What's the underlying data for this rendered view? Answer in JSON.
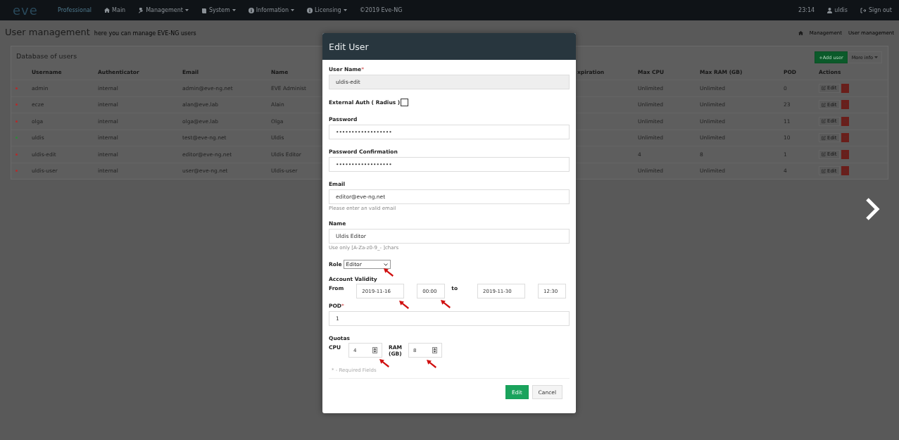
{
  "navbar": {
    "logo": "eve",
    "edition": "Professional",
    "menu": [
      {
        "label": "Main",
        "dropdown": false
      },
      {
        "label": "Management",
        "dropdown": true
      },
      {
        "label": "System",
        "dropdown": true
      },
      {
        "label": "Information",
        "dropdown": true
      },
      {
        "label": "Licensing",
        "dropdown": true
      }
    ],
    "copyright": "©2019 Eve-NG",
    "time": "23:14",
    "user": "uldis",
    "sign_out": "Sign out"
  },
  "page_header": {
    "title": "User management",
    "subtitle": "here you can manage EVE-NG users",
    "breadcrumbs": [
      "Management",
      "User management"
    ]
  },
  "panel": {
    "title": "Database of users",
    "buttons": [
      {
        "label": "+Add user",
        "kind": "primary"
      },
      {
        "label": "More info",
        "kind": "dropdown"
      }
    ],
    "columns": [
      "Username",
      "Authenticator",
      "Email",
      "Name",
      "xpiration",
      "Max CPU",
      "Max RAM (GB)",
      "POD",
      "Actions"
    ],
    "rows": [
      {
        "color": "#b52a2a",
        "username": "admin",
        "authenticator": "internal",
        "email": "admin@eve-ng.net",
        "name": "EVE Administ",
        "max_cpu": "Unlimited",
        "max_ram": "Unlimited",
        "pod": "0",
        "action": "Edit"
      },
      {
        "color": "#b52a2a",
        "username": "ecze",
        "authenticator": "internal",
        "email": "alan@eve.lab",
        "name": "Alain",
        "max_cpu": "Unlimited",
        "max_ram": "Unlimited",
        "pod": "23",
        "action": "Edit"
      },
      {
        "color": "#b52a2a",
        "username": "olga",
        "authenticator": "internal",
        "email": "olga@eve.lab",
        "name": "Olga",
        "max_cpu": "Unlimited",
        "max_ram": "Unlimited",
        "pod": "11",
        "action": "Edit"
      },
      {
        "color": "#2f8a3a",
        "username": "uldis",
        "authenticator": "internal",
        "email": "test@eve-ng.net",
        "name": "Uldis",
        "max_cpu": "Unlimited",
        "max_ram": "Unlimited",
        "pod": "10",
        "action": "Edit"
      },
      {
        "color": "#b52a2a",
        "username": "uldis-edit",
        "authenticator": "internal",
        "email": "editor@eve-ng.net",
        "name": "Uldis Editor",
        "max_cpu": "4",
        "max_ram": "8",
        "pod": "1",
        "action": "Edit"
      },
      {
        "color": "#b52a2a",
        "username": "uldis-user",
        "authenticator": "internal",
        "email": "user@eve-ng.net",
        "name": "Uldis-user",
        "max_cpu": "Unlimited",
        "max_ram": "Unlimited",
        "pod": "4",
        "action": "Edit"
      }
    ]
  },
  "modal": {
    "title": "Edit User",
    "fields": [
      {
        "kind": "text",
        "label": "User Name",
        "mark": "*",
        "value": "uldis-edit",
        "disabled": true
      },
      {
        "kind": "checkbox",
        "label": "External Auth ( Radius )",
        "checked": false
      },
      {
        "kind": "text",
        "label": "Password",
        "value": "••••••••••••••••••",
        "disabled": false
      },
      {
        "kind": "text",
        "label": "Password Confirmation",
        "value": "••••••••••••••••••",
        "disabled": false
      },
      {
        "kind": "text",
        "label": "Email",
        "value": "editor@eve-ng.net",
        "help": "Please enter an valid email",
        "disabled": false
      },
      {
        "kind": "text",
        "label": "Name",
        "value": "Uldis Editor",
        "help": "Use only [A-Za-z0-9_- ]chars",
        "disabled": false
      },
      {
        "kind": "select",
        "label": "Role",
        "value": "Editor"
      },
      {
        "kind": "validity",
        "label": "Account Validity",
        "from_label": "From",
        "from_date": "2019-11-16",
        "from_time": "00:00",
        "to_label": "to",
        "to_date": "2019-11-30",
        "to_time": "12:30"
      },
      {
        "kind": "text",
        "label": "POD",
        "mark": "*",
        "value": "1",
        "disabled": false
      },
      {
        "kind": "quotas",
        "label": "Quotas",
        "cpu_label": "CPU",
        "cpu": "4",
        "ram_label": "RAM (GB)",
        "ram": "8"
      }
    ],
    "note": "* - Required Fields",
    "buttons": [
      {
        "label": "Edit",
        "kind": "primary"
      },
      {
        "label": "Cancel",
        "kind": "default"
      }
    ]
  }
}
